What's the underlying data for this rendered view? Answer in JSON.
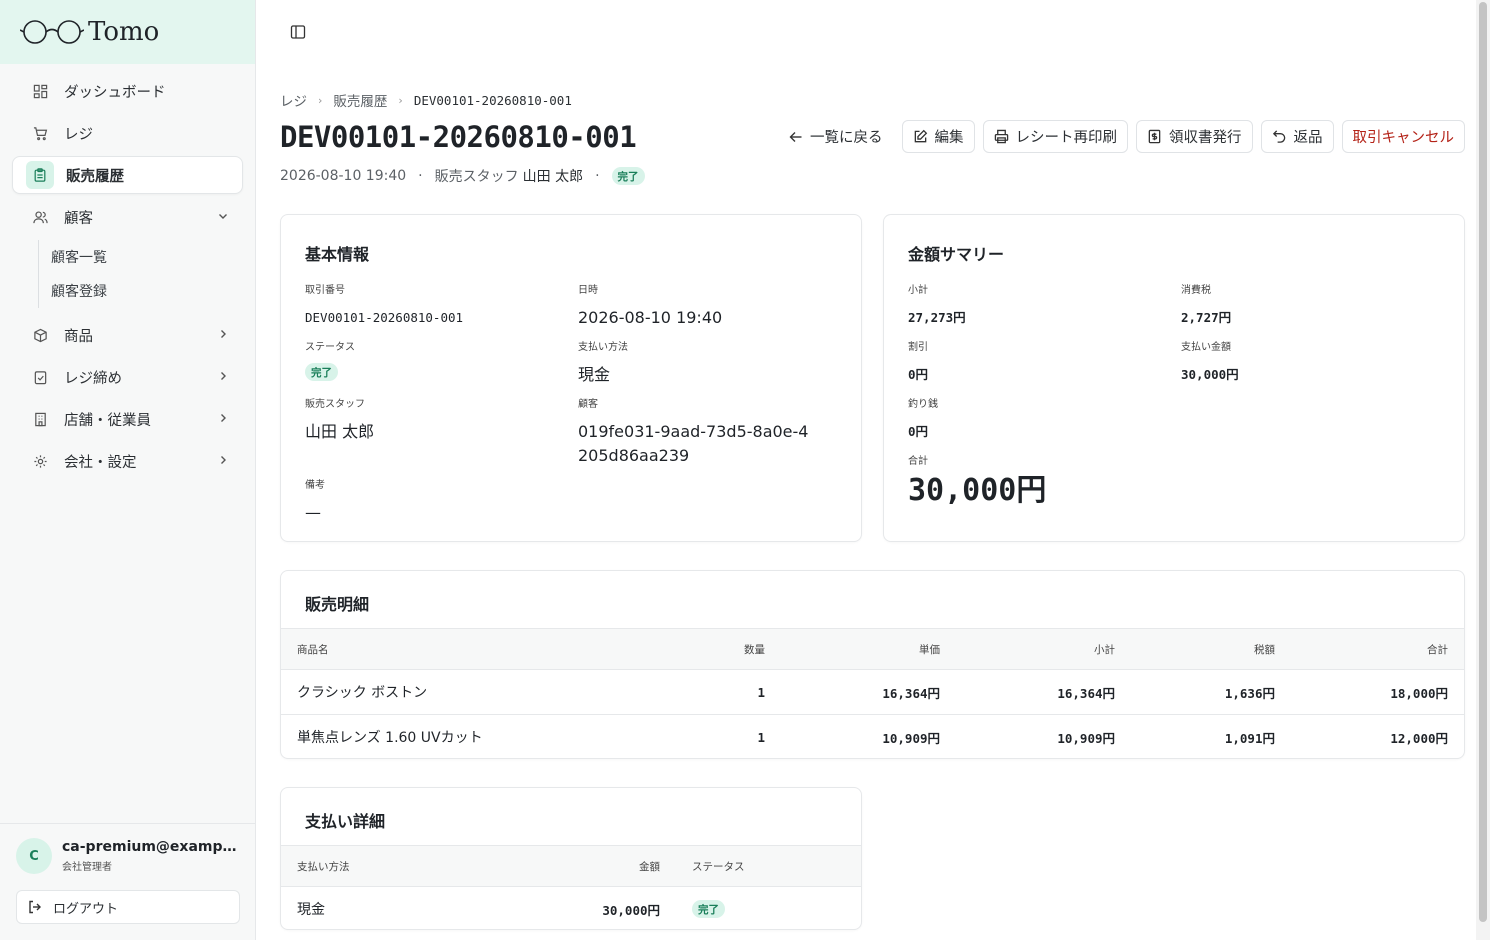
{
  "app": {
    "name": "Tomo"
  },
  "sidebar": {
    "items": [
      {
        "label": "ダッシュボード"
      },
      {
        "label": "レジ"
      },
      {
        "label": "販売履歴"
      },
      {
        "label": "顧客"
      },
      {
        "label": "商品"
      },
      {
        "label": "レジ締め"
      },
      {
        "label": "店舗・従業員"
      },
      {
        "label": "会社・設定"
      }
    ],
    "customer_sub": [
      "顧客一覧",
      "顧客登録"
    ]
  },
  "user": {
    "initial": "C",
    "email": "ca-premium@example.com",
    "role": "会社管理者",
    "logout_label": "ログアウト"
  },
  "breadcrumb": {
    "items": [
      "レジ",
      "販売履歴"
    ],
    "current": "DEV00101-20260810-001"
  },
  "page": {
    "title": "DEV00101-20260810-001",
    "datetime": "2026-08-10 19:40",
    "staff_label": "販売スタッフ",
    "staff_name": "山田 太郎",
    "status": "完了"
  },
  "actions": {
    "back": "一覧に戻る",
    "edit": "編集",
    "reprint": "レシート再印刷",
    "receipt": "領収書発行",
    "refund": "返品",
    "cancel": "取引キャンセル"
  },
  "basic": {
    "title": "基本情報",
    "txn_label": "取引番号",
    "txn_value": "DEV00101-20260810-001",
    "date_label": "日時",
    "date_value": "2026-08-10 19:40",
    "status_label": "ステータス",
    "status_value": "完了",
    "pay_label": "支払い方法",
    "pay_value": "現金",
    "staff_label": "販売スタッフ",
    "staff_value": "山田 太郎",
    "customer_label": "顧客",
    "customer_value": "019fe031-9aad-73d5-8a0e-4205d86aa239",
    "note_label": "備考",
    "note_value": "—"
  },
  "summary": {
    "title": "金額サマリー",
    "subtotal_label": "小計",
    "subtotal_value": "27,273円",
    "tax_label": "消費税",
    "tax_value": "2,727円",
    "discount_label": "割引",
    "discount_value": "0円",
    "paid_label": "支払い金額",
    "paid_value": "30,000円",
    "change_label": "釣り銭",
    "change_value": "0円",
    "total_label": "合計",
    "total_value": "30,000円"
  },
  "items": {
    "title": "販売明細",
    "headers": [
      "商品名",
      "数量",
      "単価",
      "小計",
      "税額",
      "合計"
    ],
    "rows": [
      [
        "クラシック ボストン",
        "1",
        "16,364円",
        "16,364円",
        "1,636円",
        "18,000円"
      ],
      [
        "単焦点レンズ 1.60 UVカット",
        "1",
        "10,909円",
        "10,909円",
        "1,091円",
        "12,000円"
      ]
    ]
  },
  "payments": {
    "title": "支払い詳細",
    "headers": [
      "支払い方法",
      "金額",
      "ステータス"
    ],
    "rows": [
      [
        "現金",
        "30,000円",
        "完了"
      ]
    ]
  },
  "colors": {
    "accent": "#1a7f5a",
    "accent_bg": "#d8f3e9",
    "logo_bg": "#e3f6ef",
    "danger": "#b42318"
  }
}
